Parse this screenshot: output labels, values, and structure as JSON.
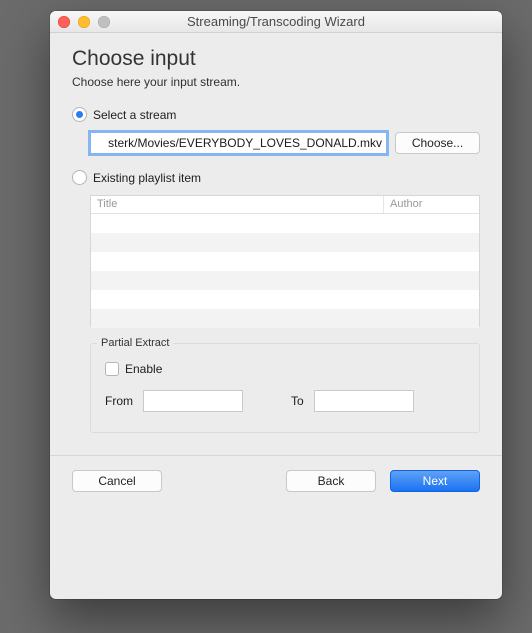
{
  "window": {
    "title": "Streaming/Transcoding Wizard"
  },
  "page": {
    "heading": "Choose input",
    "subheading": "Choose here your input stream."
  },
  "options": {
    "select_stream_label": "Select a stream",
    "existing_playlist_label": "Existing playlist item",
    "selected": "select_stream"
  },
  "stream": {
    "path_value": "sterk/Movies/EVERYBODY_LOVES_DONALD.mkv",
    "choose_label": "Choose..."
  },
  "playlist": {
    "col_title": "Title",
    "col_author": "Author",
    "rows": []
  },
  "partial": {
    "legend": "Partial Extract",
    "enable_label": "Enable",
    "from_label": "From",
    "to_label": "To",
    "from_value": "",
    "to_value": ""
  },
  "buttons": {
    "cancel": "Cancel",
    "back": "Back",
    "next": "Next"
  }
}
